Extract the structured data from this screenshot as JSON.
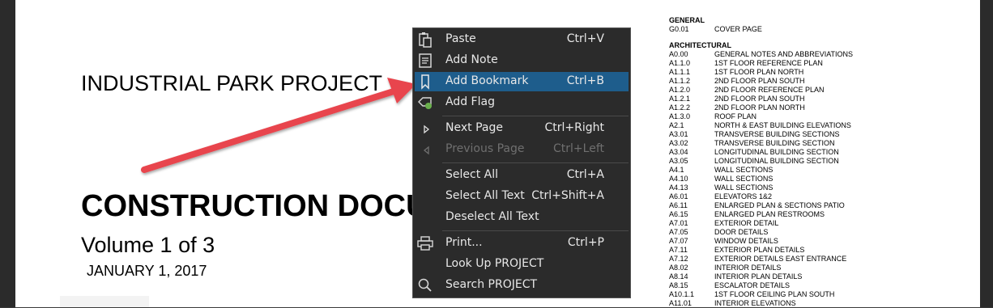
{
  "document": {
    "project_name": "INDUSTRIAL PARK PROJECT",
    "title": "CONSTRUCTION DOCUMENTS",
    "volume": "Volume 1 of 3",
    "date": "JANUARY 1, 2017"
  },
  "sheet_index": {
    "general": {
      "title": "GENERAL",
      "rows": [
        {
          "code": "G0.01",
          "desc": "COVER PAGE"
        }
      ]
    },
    "architectural": {
      "title": "ARCHITECTURAL",
      "rows": [
        {
          "code": "A0.00",
          "desc": "GENERAL NOTES AND ABBREVIATIONS"
        },
        {
          "code": "A1.1.0",
          "desc": "1ST FLOOR REFERENCE PLAN"
        },
        {
          "code": "A1.1.1",
          "desc": "1ST FLOOR PLAN NORTH"
        },
        {
          "code": "A1.1.2",
          "desc": "2ND FLOOR PLAN SOUTH"
        },
        {
          "code": "A1.2.0",
          "desc": "2ND FLOOR REFERENCE PLAN"
        },
        {
          "code": "A1.2.1",
          "desc": "2ND FLOOR PLAN SOUTH"
        },
        {
          "code": "A1.2.2",
          "desc": "2ND FLOOR PLAN NORTH"
        },
        {
          "code": "A1.3.0",
          "desc": "ROOF PLAN"
        },
        {
          "code": "A2.1",
          "desc": "NORTH & EAST BUILDING ELEVATIONS"
        },
        {
          "code": "A3.01",
          "desc": "TRANSVERSE BUILDING SECTIONS"
        },
        {
          "code": "A3.02",
          "desc": "TRANSVERSE BUILDING SECTION"
        },
        {
          "code": "A3.04",
          "desc": "LONGITUDINAL BUILDING SECTION"
        },
        {
          "code": "A3.05",
          "desc": "LONGITUDINAL BUILDING SECTION"
        },
        {
          "code": "A4.1",
          "desc": "WALL SECTIONS"
        },
        {
          "code": "A4.10",
          "desc": "WALL SECTIONS"
        },
        {
          "code": "A4.13",
          "desc": "WALL SECTIONS"
        },
        {
          "code": "A6.01",
          "desc": "ELEVATORS 1&2"
        },
        {
          "code": "A6.11",
          "desc": "ENLARGED PLAN & SECTIONS PATIO"
        },
        {
          "code": "A6.15",
          "desc": "ENLARGED PLAN RESTROOMS"
        },
        {
          "code": "A7.01",
          "desc": "EXTERIOR DETAIL"
        },
        {
          "code": "A7.05",
          "desc": "DOOR DETAILS"
        },
        {
          "code": "A7.07",
          "desc": "WINDOW DETAILS"
        },
        {
          "code": "A7.11",
          "desc": "EXTERIOR PLAN DETAILS"
        },
        {
          "code": "A7.12",
          "desc": "EXTERIOR DETAILS EAST ENTRANCE"
        },
        {
          "code": "A8.02",
          "desc": "INTERIOR DETAILS"
        },
        {
          "code": "A8.14",
          "desc": "INTERIOR PLAN DETAILS"
        },
        {
          "code": "A8.15",
          "desc": "ESCALATOR DETAILS"
        },
        {
          "code": "A10.1.1",
          "desc": "1ST FLOOR CEILING PLAN SOUTH"
        },
        {
          "code": "A11.01",
          "desc": "INTERIOR ELEVATIONS"
        }
      ]
    }
  },
  "context_menu": {
    "items": [
      {
        "label": "Paste",
        "shortcut": "Ctrl+V",
        "icon": "paste-icon",
        "enabled": true,
        "highlighted": false
      },
      {
        "label": "Add Note",
        "shortcut": "",
        "icon": "note-icon",
        "enabled": true,
        "highlighted": false
      },
      {
        "label": "Add Bookmark",
        "shortcut": "Ctrl+B",
        "icon": "bookmark-icon",
        "enabled": true,
        "highlighted": true
      },
      {
        "label": "Add Flag",
        "shortcut": "",
        "icon": "flag-icon",
        "enabled": true,
        "highlighted": false
      },
      {
        "label": "Next Page",
        "shortcut": "Ctrl+Right",
        "icon": "next-page-icon",
        "enabled": true,
        "highlighted": false
      },
      {
        "label": "Previous Page",
        "shortcut": "Ctrl+Left",
        "icon": "previous-page-icon",
        "enabled": false,
        "highlighted": false
      },
      {
        "label": "Select All",
        "shortcut": "Ctrl+A",
        "icon": "",
        "enabled": true,
        "highlighted": false
      },
      {
        "label": "Select All Text",
        "shortcut": "Ctrl+Shift+A",
        "icon": "",
        "enabled": true,
        "highlighted": false
      },
      {
        "label": "Deselect All Text",
        "shortcut": "",
        "icon": "",
        "enabled": true,
        "highlighted": false
      },
      {
        "label": "Print...",
        "shortcut": "Ctrl+P",
        "icon": "print-icon",
        "enabled": true,
        "highlighted": false
      },
      {
        "label": "Look Up PROJECT",
        "shortcut": "",
        "icon": "",
        "enabled": true,
        "highlighted": false
      },
      {
        "label": "Search PROJECT",
        "shortcut": "",
        "icon": "search-icon",
        "enabled": true,
        "highlighted": false
      }
    ]
  },
  "colors": {
    "menu_background": "#2b2b2b",
    "menu_highlight": "#1e5d8c",
    "annotation_arrow": "#e8454d",
    "flag_accent": "#6ab04c"
  }
}
